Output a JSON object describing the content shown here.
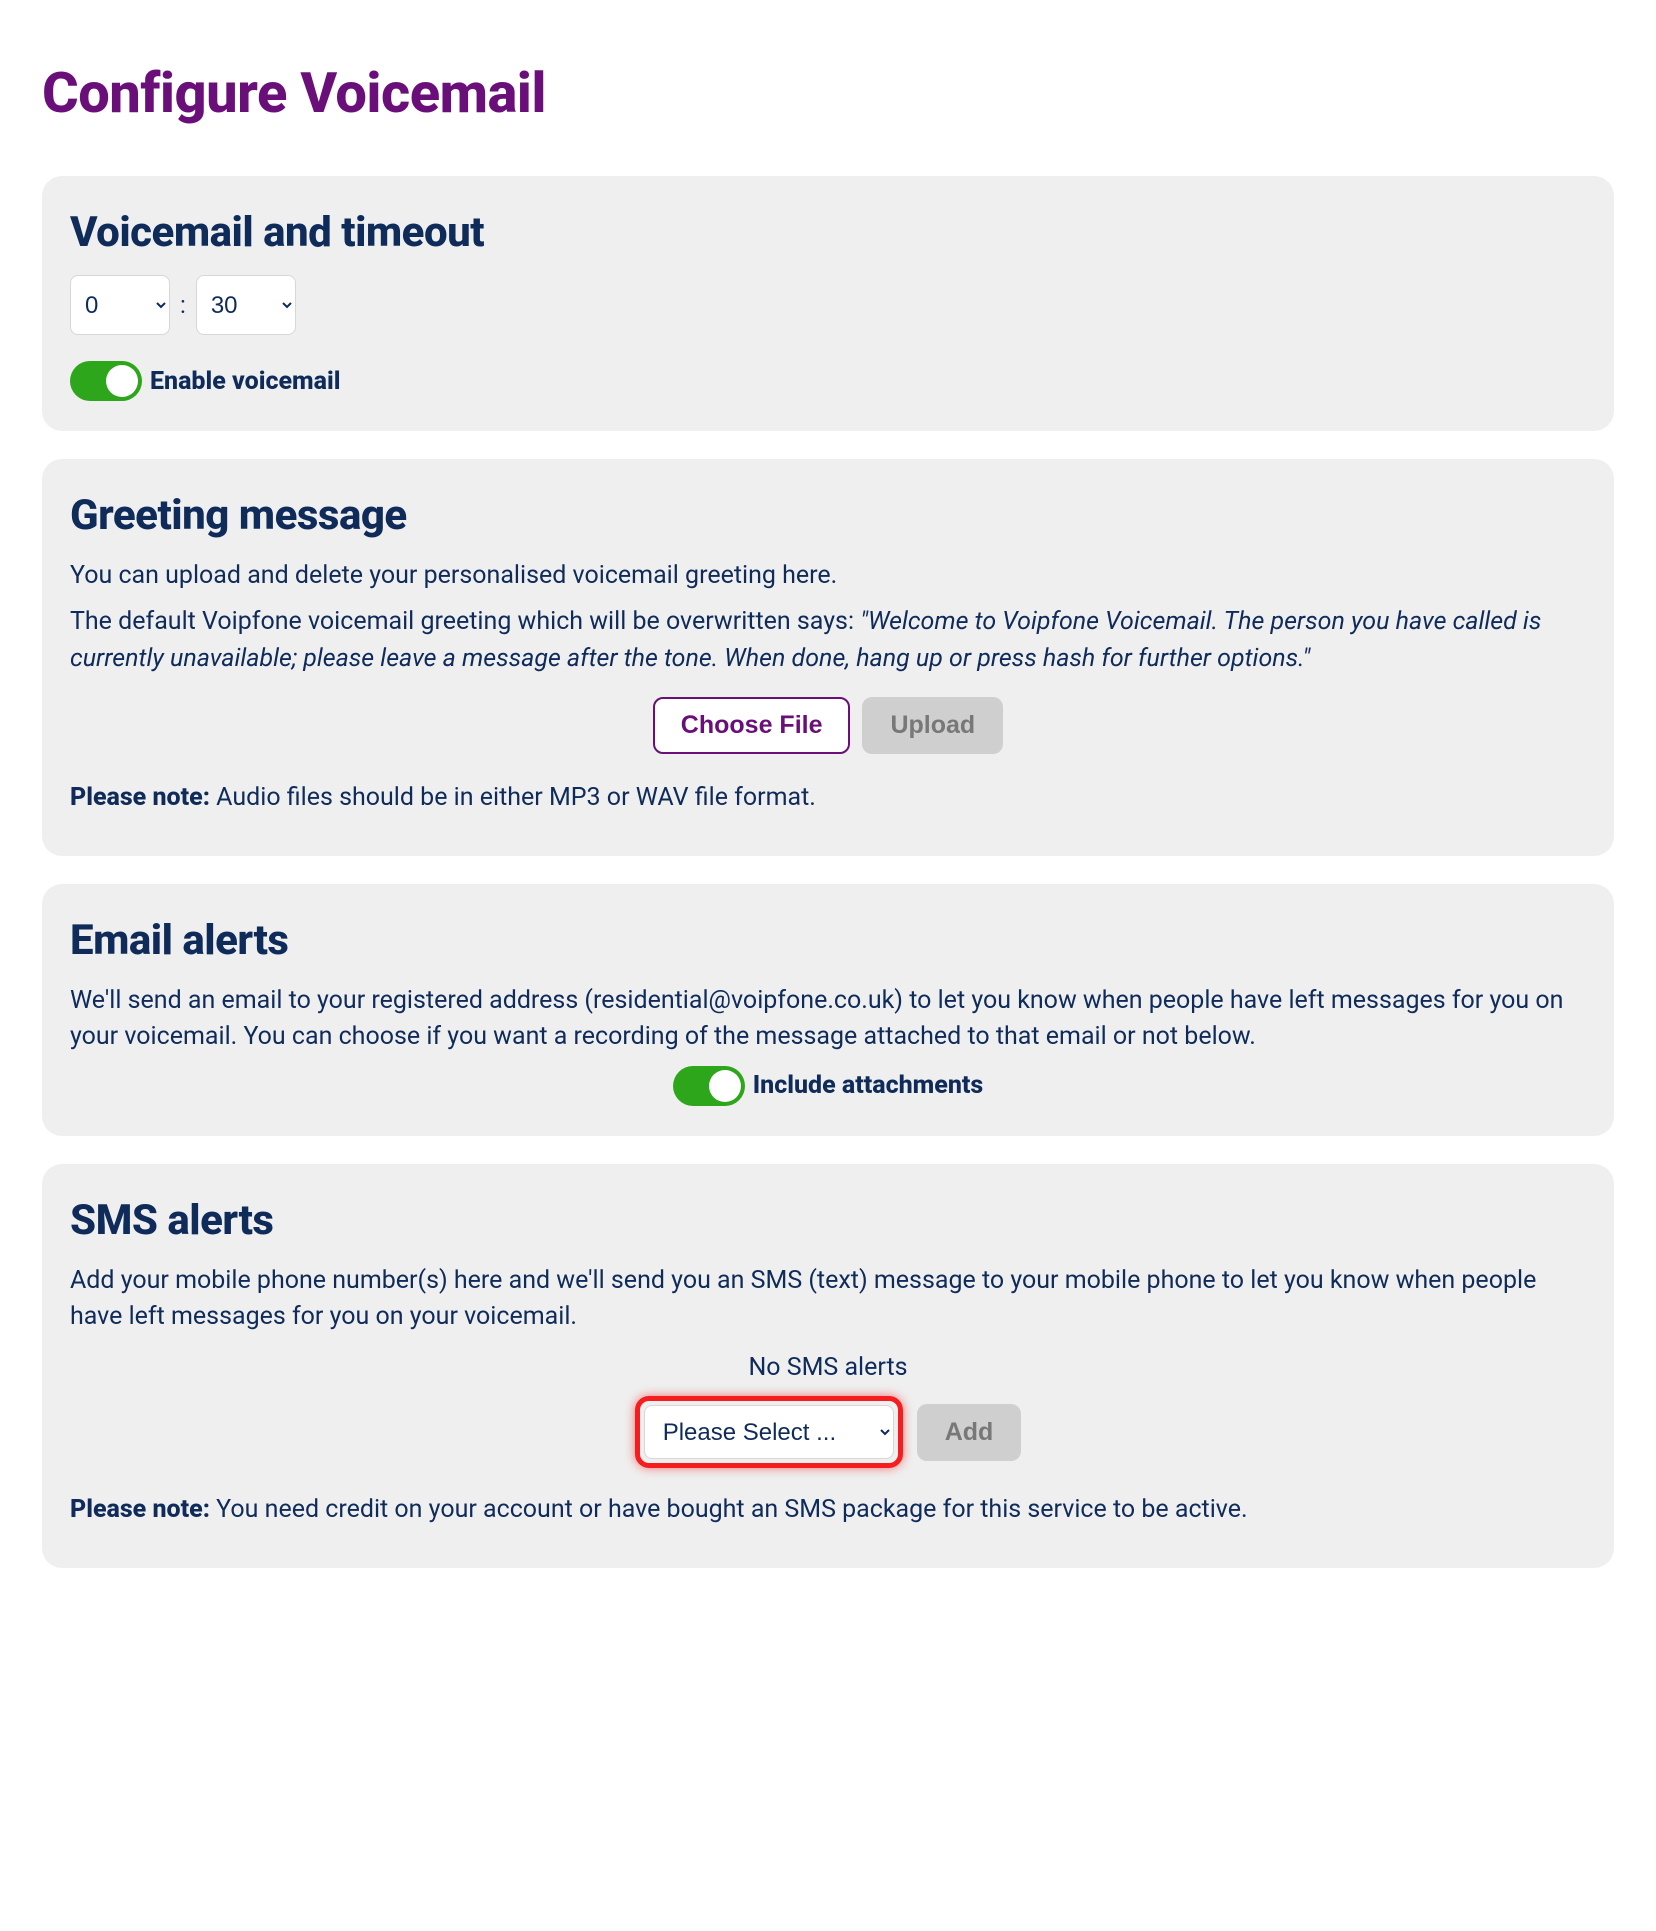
{
  "page": {
    "title": "Configure Voicemail"
  },
  "timeout": {
    "heading": "Voicemail and timeout",
    "minutes_value": "0",
    "separator": ":",
    "seconds_value": "30",
    "toggle_label": "Enable voicemail",
    "toggle_on": true
  },
  "greeting": {
    "heading": "Greeting message",
    "line1": "You can upload and delete your personalised voicemail greeting here.",
    "line2_prefix": "The default Voipfone voicemail greeting which will be overwritten says: ",
    "line2_quote": "\"Welcome to Voipfone Voicemail. The person you have called is currently unavailable; please leave a message after the tone. When done, hang up or press hash for further options.\"",
    "choose_file_label": "Choose File",
    "upload_label": "Upload",
    "note_label": "Please note:",
    "note_text": " Audio files should be in either MP3 or WAV file format."
  },
  "email": {
    "heading": "Email alerts",
    "body": "We'll send an email to your registered address (residential@voipfone.co.uk) to let you know when people have left messages for you on your voicemail. You can choose if you want a recording of the message attached to that email or not below.",
    "toggle_label": "Include attachments",
    "toggle_on": true
  },
  "sms": {
    "heading": "SMS alerts",
    "body": "Add your mobile phone number(s) here and we'll send you an SMS (text) message to your mobile phone to let you know when people have left messages for you on your voicemail.",
    "status": "No SMS alerts",
    "select_value": "Please Select ...",
    "add_label": "Add",
    "note_label": "Please note:",
    "note_text": " You need credit on your account or have bought an SMS package for this service to be active."
  }
}
